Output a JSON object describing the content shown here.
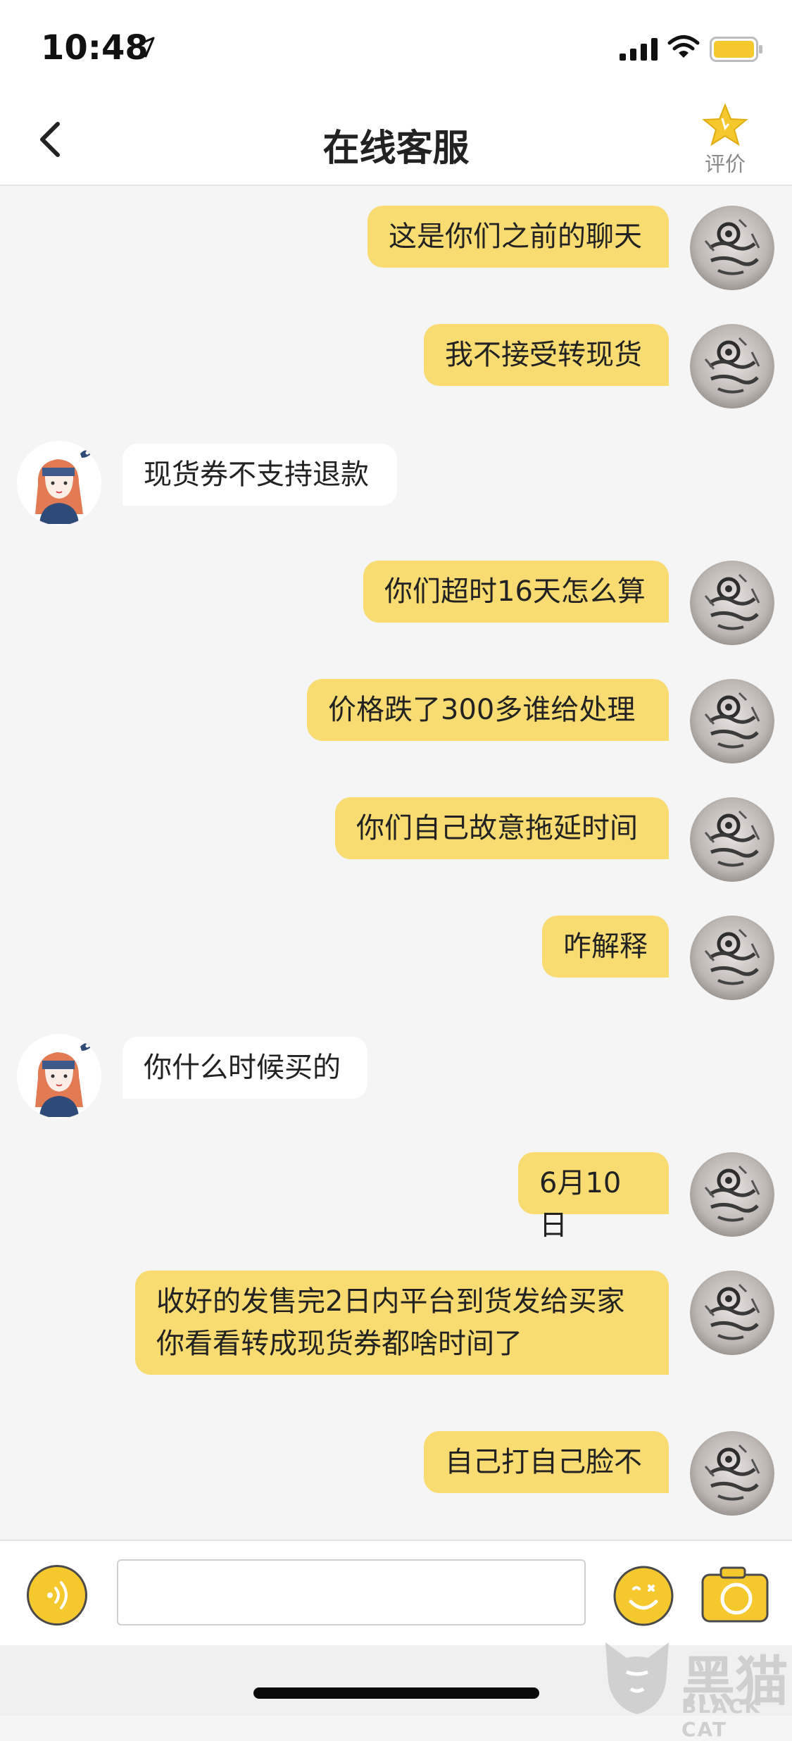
{
  "status_bar": {
    "time": "10:48"
  },
  "header": {
    "title": "在线客服",
    "rate_label": "评价"
  },
  "messages": [
    {
      "from": "me",
      "text": "这是你们之前的聊天"
    },
    {
      "from": "me",
      "text": "我不接受转现货"
    },
    {
      "from": "service",
      "text": "现货券不支持退款"
    },
    {
      "from": "me",
      "text": "你们超时16天怎么算"
    },
    {
      "from": "me",
      "text": "价格跌了300多谁给处理"
    },
    {
      "from": "me",
      "text": "你们自己故意拖延时间"
    },
    {
      "from": "me",
      "text": "咋解释"
    },
    {
      "from": "service",
      "text": "你什么时候买的"
    },
    {
      "from": "me",
      "text": "6月10日"
    },
    {
      "from": "me",
      "line1": "收好的发售完2日内平台到货发给买家",
      "line2": "你看看转成现货券都啥时间了"
    },
    {
      "from": "me",
      "text": "自己打自己脸不"
    }
  ],
  "input": {
    "value": ""
  },
  "watermark": {
    "zh": "黑猫",
    "en": "BLACK CAT"
  },
  "colors": {
    "bubble_me": "#f8dc72",
    "accent": "#f5c82e",
    "bubble_service": "#ffffff"
  }
}
